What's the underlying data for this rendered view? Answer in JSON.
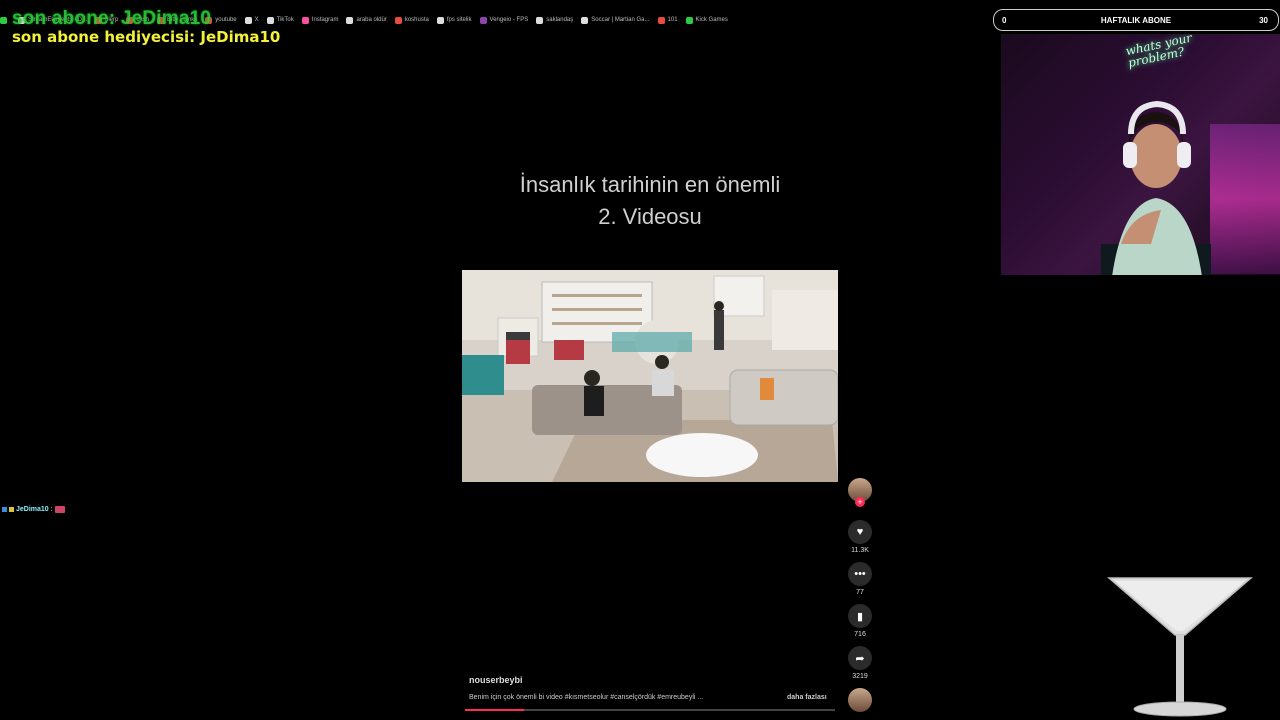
{
  "bookmarks": [
    {
      "label": "",
      "color": "green"
    },
    {
      "label": "StreamElements - D...",
      "color": "white"
    },
    {
      "label": "blerp",
      "color": "red"
    },
    {
      "label": "cash",
      "color": "red"
    },
    {
      "label": "Bitly | Links",
      "color": "red"
    },
    {
      "label": "youtube",
      "color": "red"
    },
    {
      "label": "X",
      "color": "white"
    },
    {
      "label": "TikTok",
      "color": "white"
    },
    {
      "label": "Instagram",
      "color": "pink"
    },
    {
      "label": "araba oldür",
      "color": "white"
    },
    {
      "label": "koshusta",
      "color": "red"
    },
    {
      "label": "fps sitelik",
      "color": "white"
    },
    {
      "label": "Vengeio - FPS",
      "color": "purple"
    },
    {
      "label": "saklandaş",
      "color": "white"
    },
    {
      "label": "Soccar | Martian Ga...",
      "color": "white"
    },
    {
      "label": "101",
      "color": "red"
    },
    {
      "label": "Kick Games",
      "color": "green"
    }
  ],
  "overlay": {
    "last_sub_alert": "son abone: JeDima10",
    "last_sub_gift": "son abone hediyecisi: JeDima10",
    "goal": {
      "current": "0",
      "label": "HAFTALIK ABONE",
      "target": "30"
    },
    "chat": {
      "user": "JeDima10",
      "separator": ":"
    }
  },
  "webcam": {
    "neon_sign": "whats your problem?"
  },
  "video": {
    "title_line1": "İnsanlık tarihinin en önemli",
    "title_line2": "2. Videosu",
    "likes": "11.3K",
    "comments": "77",
    "saves": "716",
    "shares": "3219",
    "username": "nouserbeybi",
    "caption": "Benim için çok önemli bi video #kısmetseolur #canselçördük #emreubeyli ...",
    "more_label": "daha fazlası",
    "progress": 0.16
  },
  "colors": {
    "accent": "#fe2c55",
    "sub_alert": "#2ecc40",
    "gift": "#f4f13a"
  }
}
